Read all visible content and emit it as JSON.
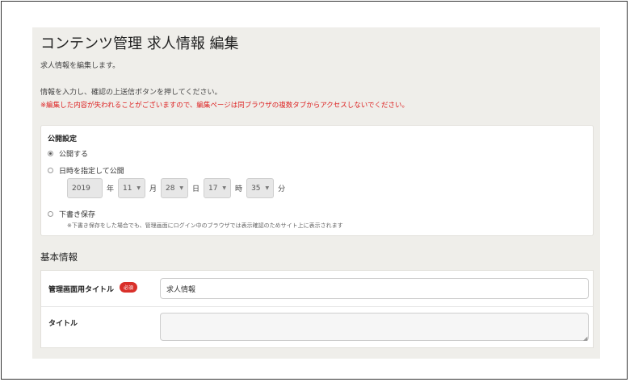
{
  "header": {
    "title": "コンテンツ管理 求人情報 編集",
    "subtitle": "求人情報を編集します。",
    "instruction": "情報を入力し、確認の上送信ボタンを押してください。",
    "warning": "※編集した内容が失われることがございますので、編集ページは同ブラウザの複数タブからアクセスしないでください。"
  },
  "publish": {
    "heading": "公開設定",
    "options": [
      {
        "label": "公開する",
        "checked": true
      },
      {
        "label": "日時を指定して公開",
        "checked": false
      },
      {
        "label": "下書き保存",
        "checked": false
      }
    ],
    "date": {
      "year": "2019",
      "year_unit": "年",
      "month": "11",
      "month_unit": "月",
      "day": "28",
      "day_unit": "日",
      "hour": "17",
      "hour_unit": "時",
      "minute": "35",
      "minute_unit": "分"
    },
    "draft_note": "※下書き保存をした場合でも、管理画面にログイン中のブラウザでは表示確認のためサイト上に表示されます"
  },
  "basic": {
    "section_title": "基本情報",
    "fields": [
      {
        "label": "管理画面用タイトル",
        "badge": "必須",
        "value": "求人情報"
      },
      {
        "label": "タイトル",
        "value": ""
      }
    ]
  },
  "colors": {
    "panel_bg": "#efeeea",
    "warning": "#dd2222",
    "required_badge": "#d9302a"
  },
  "icons": {
    "select_arrow": "chevron-down-icon",
    "textarea_resize": "resize-grip-icon"
  }
}
